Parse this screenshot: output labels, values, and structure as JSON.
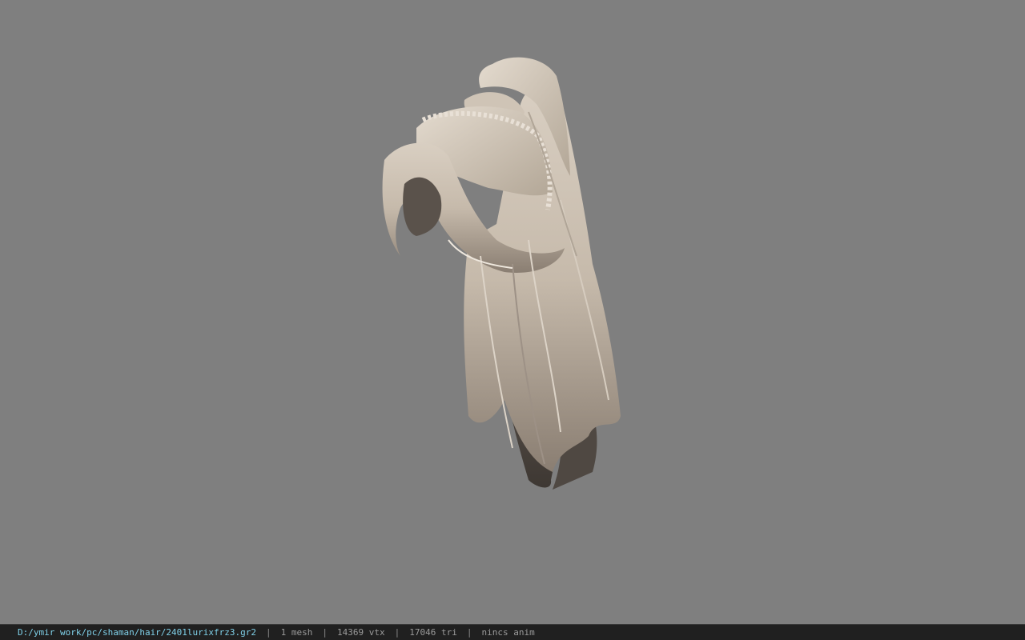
{
  "viewport": {
    "background": "#7f7f7f",
    "model_icon": "hair-mesh-model"
  },
  "statusbar": {
    "file_path": "D:/ymir work/pc/shaman/hair/2401lurixfrz3.gr2",
    "separator": "|",
    "mesh_count": "1 mesh",
    "vertex_count": "14369 vtx",
    "triangle_count": "17046 tri",
    "anim_status": "nincs anim",
    "path_color": "#7fd0e8"
  }
}
